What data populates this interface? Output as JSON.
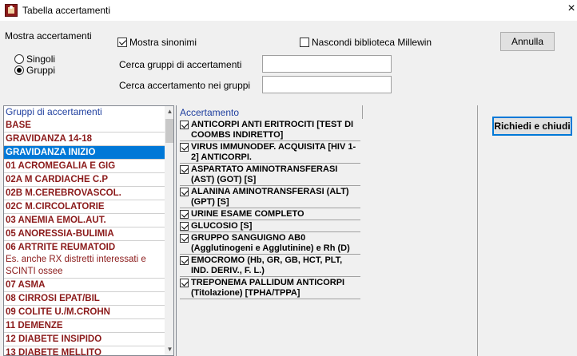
{
  "window": {
    "title": "Tabella accertamenti",
    "close_glyph": "×"
  },
  "options": {
    "mostra_label": "Mostra accertamenti",
    "radio_singoli": "Singoli",
    "radio_gruppi": "Gruppi",
    "selected_mode": "Gruppi",
    "sinonimi_label": "Mostra sinonimi",
    "sinonimi_checked": true,
    "nascondi_label": "Nascondi biblioteca Millewin",
    "nascondi_checked": false
  },
  "search": {
    "gruppi_label": "Cerca gruppi di accertamenti",
    "gruppi_value": "",
    "accertamento_label": "Cerca accertamento nei gruppi",
    "accertamento_value": ""
  },
  "buttons": {
    "annulla": "Annulla",
    "richiedi": "Richiedi e chiudi"
  },
  "groups": {
    "header": "Gruppi di accertamenti",
    "items": [
      "BASE",
      "GRAVIDANZA 14-18",
      "GRAVIDANZA INIZIO",
      "01 ACROMEGALIA E GIG",
      "02A M CARDIACHE C.P",
      "02B M.CEREBROVASCOL.",
      "02C M.CIRCOLATORIE",
      "03 ANEMIA EMOL.AUT.",
      "05 ANORESSIA-BULIMIA",
      "06 ARTRITE REUMATOID",
      "07 ASMA",
      "08 CIRROSI EPAT/BIL",
      "09 COLITE U./M.CROHN",
      "11 DEMENZE",
      "12 DIABETE INSIPIDO",
      "13 DIABETE MELLITO"
    ],
    "artrite_note": "Es. anche RX distretti interessati e SCINTI ossee",
    "selected": "GRAVIDANZA INIZIO"
  },
  "tests": {
    "header": "Accertamento",
    "items": [
      {
        "label": "ANTICORPI ANTI ERITROCITI [TEST DI COOMBS INDIRETTO]",
        "checked": true
      },
      {
        "label": "VIRUS IMMUNODEF. ACQUISITA [HIV 1-2] ANTICORPI.",
        "checked": true
      },
      {
        "label": "ASPARTATO AMINOTRANSFERASI (AST) (GOT) [S]",
        "checked": true
      },
      {
        "label": "ALANINA AMINOTRANSFERASI (ALT) (GPT) [S]",
        "checked": true
      },
      {
        "label": "URINE ESAME COMPLETO",
        "checked": true
      },
      {
        "label": "GLUCOSIO [S]",
        "checked": true
      },
      {
        "label": "GRUPPO SANGUIGNO AB0 (Agglutinogeni e Agglutinine) e Rh (D)",
        "checked": true
      },
      {
        "label": "EMOCROMO (Hb, GR, GB, HCT, PLT, IND. DERIV., F. L.)",
        "checked": true
      },
      {
        "label": "TREPONEMA PALLIDUM ANTICORPI (Titolazione) [TPHA/TPPA]",
        "checked": true
      }
    ]
  }
}
